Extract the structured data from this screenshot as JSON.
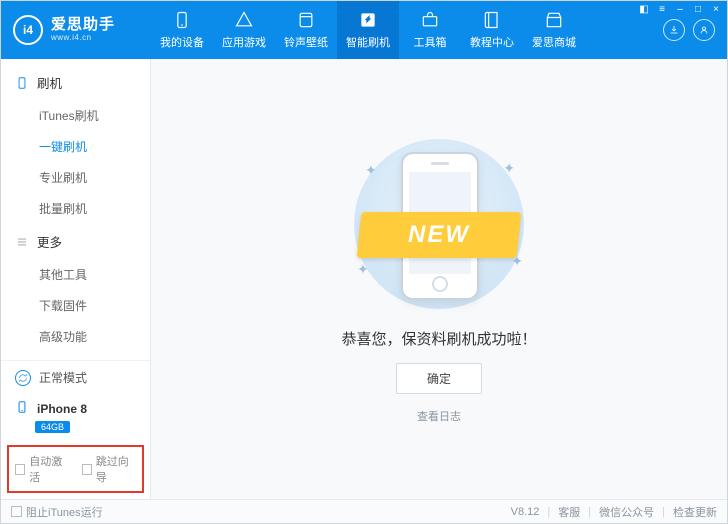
{
  "brand": {
    "logo_text": "i4",
    "name": "爱思助手",
    "url": "www.i4.cn"
  },
  "nav": [
    {
      "key": "devices",
      "label": "我的设备"
    },
    {
      "key": "apps",
      "label": "应用游戏"
    },
    {
      "key": "ring",
      "label": "铃声壁纸"
    },
    {
      "key": "flash",
      "label": "智能刷机"
    },
    {
      "key": "toolbox",
      "label": "工具箱"
    },
    {
      "key": "tutorial",
      "label": "教程中心"
    },
    {
      "key": "store",
      "label": "爱思商城"
    }
  ],
  "sidebar": {
    "group_flash": {
      "title": "刷机",
      "items": [
        {
          "key": "itunes",
          "label": "iTunes刷机"
        },
        {
          "key": "onekey",
          "label": "一键刷机"
        },
        {
          "key": "pro",
          "label": "专业刷机"
        },
        {
          "key": "batch",
          "label": "批量刷机"
        }
      ]
    },
    "group_more": {
      "title": "更多",
      "items": [
        {
          "key": "other",
          "label": "其他工具"
        },
        {
          "key": "firmware",
          "label": "下载固件"
        },
        {
          "key": "advanced",
          "label": "高级功能"
        }
      ]
    },
    "mode_label": "正常模式",
    "device_name": "iPhone 8",
    "device_badge": "64GB",
    "check_auto_activate": "自动激活",
    "check_skip_guide": "跳过向导"
  },
  "main": {
    "ribbon": "NEW",
    "success_msg": "恭喜您，保资料刷机成功啦！",
    "ok_button": "确定",
    "view_log": "查看日志"
  },
  "footer": {
    "block_itunes": "阻止iTunes运行",
    "version": "V8.12",
    "support": "客服",
    "wechat": "微信公众号",
    "update": "检查更新"
  }
}
